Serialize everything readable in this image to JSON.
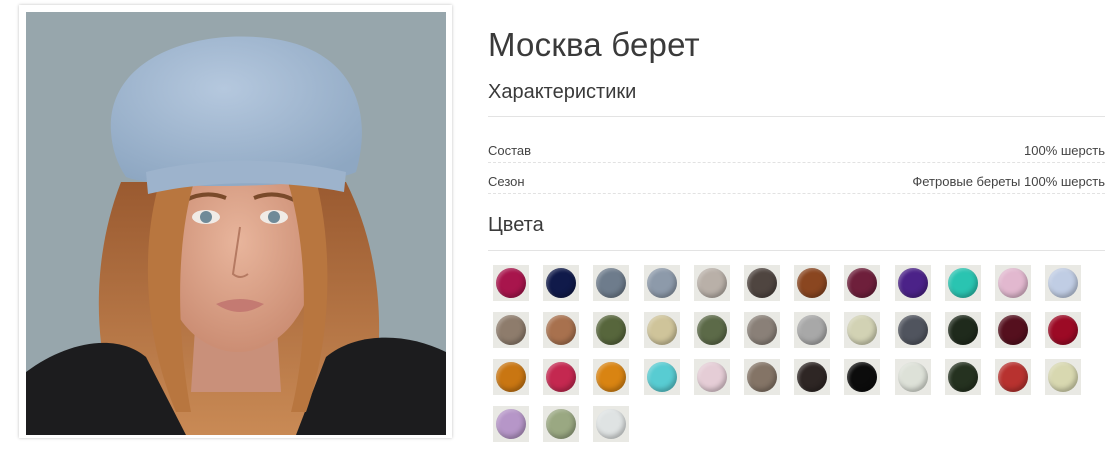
{
  "product": {
    "title": "Москва берет"
  },
  "specs": {
    "heading": "Характеристики",
    "rows": [
      {
        "key": "Состав",
        "value": "100% шерсть"
      },
      {
        "key": "Сезон",
        "value": "Фетровые береты 100% шерсть"
      }
    ]
  },
  "colors": {
    "heading": "Цвета",
    "swatches": [
      "#a8154c",
      "#101a4a",
      "#6e7c8c",
      "#8d9aaa",
      "#b9b0a8",
      "#4f4540",
      "#8a4620",
      "#6e1f3b",
      "#4b2288",
      "#2ac4b1",
      "#e2b8cf",
      "#c0cde4",
      "#8e7c6c",
      "#a8714e",
      "#57663c",
      "#cfc49a",
      "#5c6a48",
      "#8a8078",
      "#a8a8a8",
      "#d2d2b4",
      "#50545e",
      "#1f2a1c",
      "#55101e",
      "#9c0a25",
      "#c97612",
      "#c42850",
      "#d98412",
      "#58ccd2",
      "#e5cdd6",
      "#847466",
      "#2e2624",
      "#0c0c0c",
      "#dde1d8",
      "#253220",
      "#b8322f",
      "#d8d8b0",
      "#b696c8",
      "#9aa882",
      "#dfe3e3"
    ]
  }
}
